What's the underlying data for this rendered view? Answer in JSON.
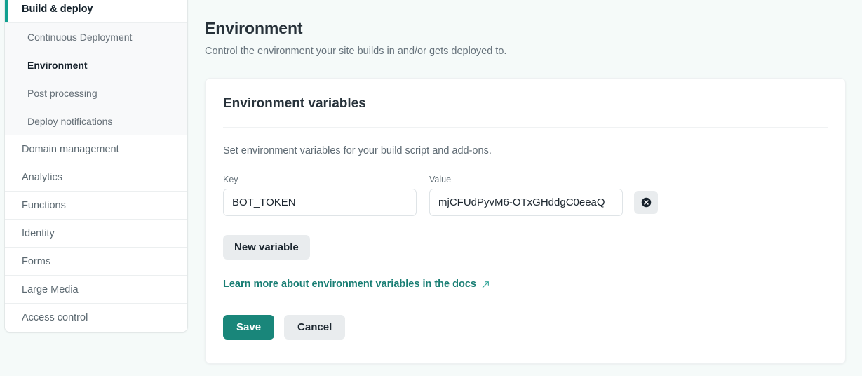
{
  "theme": {
    "accent": "#19867a",
    "accent_indicator": "#10a090",
    "link": "#197e74",
    "page_bg": "#f5faf9",
    "card_bg": "#ffffff",
    "muted_text": "#67737c"
  },
  "sidebar": {
    "items": [
      {
        "label": "Build & deploy",
        "level": "group",
        "state": "active-group"
      },
      {
        "label": "Continuous Deployment",
        "level": "sub",
        "state": "normal"
      },
      {
        "label": "Environment",
        "level": "sub",
        "state": "current"
      },
      {
        "label": "Post processing",
        "level": "sub",
        "state": "normal"
      },
      {
        "label": "Deploy notifications",
        "level": "sub",
        "state": "normal"
      },
      {
        "label": "Domain management",
        "level": "top",
        "state": "normal"
      },
      {
        "label": "Analytics",
        "level": "top",
        "state": "normal"
      },
      {
        "label": "Functions",
        "level": "top",
        "state": "normal"
      },
      {
        "label": "Identity",
        "level": "top",
        "state": "normal"
      },
      {
        "label": "Forms",
        "level": "top",
        "state": "normal"
      },
      {
        "label": "Large Media",
        "level": "top",
        "state": "normal"
      },
      {
        "label": "Access control",
        "level": "top",
        "state": "normal"
      }
    ]
  },
  "header": {
    "title": "Environment",
    "subtitle": "Control the environment your site builds in and/or gets deployed to."
  },
  "card": {
    "title": "Environment variables",
    "description": "Set environment variables for your build script and add-ons.",
    "variables": [
      {
        "key_label": "Key",
        "key_value": "BOT_TOKEN",
        "key_placeholder": "Key",
        "value_label": "Value",
        "value_value": "mjCFUdPyvM6-OTxGHddgC0eeaQ",
        "value_placeholder": "Value",
        "delete_icon": "circle-x-icon"
      }
    ],
    "new_variable_label": "New variable",
    "docs_link_label": "Learn more about environment variables in the docs",
    "docs_link_icon": "external-link-icon",
    "save_label": "Save",
    "cancel_label": "Cancel"
  }
}
